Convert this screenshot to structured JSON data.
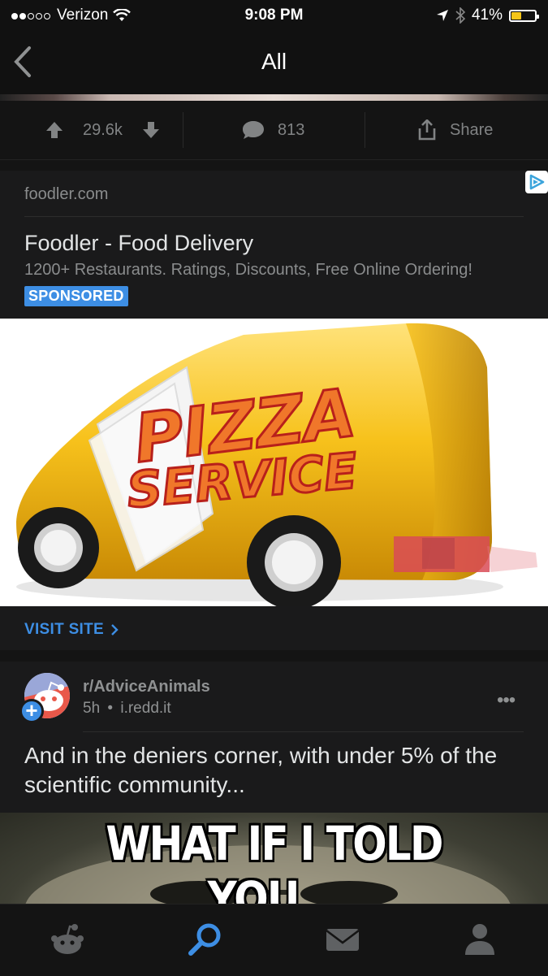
{
  "status_bar": {
    "carrier": "Verizon",
    "time": "9:08 PM",
    "battery": "41%",
    "battery_level": 0.41
  },
  "nav": {
    "title": "All",
    "back_icon": "chevron-left-icon"
  },
  "action_bar": {
    "score": "29.6k",
    "comments": "813",
    "share_label": "Share"
  },
  "ad": {
    "domain": "foodler.com",
    "title": "Foodler - Food Delivery",
    "description": "1200+ Restaurants. Ratings, Discounts, Free Online Ordering!",
    "badge": "SPONSORED",
    "image_text_line1": "PIZZA",
    "image_text_line2": "SERVICE",
    "cta": "VISIT SITE"
  },
  "post": {
    "subreddit": "r/AdviceAnimals",
    "age": "5h",
    "source": "i.redd.it",
    "title": "And in the deniers corner, with under 5% of the scientific community...",
    "image_caption": "WHAT IF I TOLD YOU..."
  },
  "tabs": [
    {
      "icon": "home-icon"
    },
    {
      "icon": "search-icon",
      "active": true
    },
    {
      "icon": "inbox-icon"
    },
    {
      "icon": "profile-icon"
    }
  ],
  "colors": {
    "accent": "#3d8ee4",
    "background": "#141414",
    "card": "#1a1a1b",
    "muted": "#818384"
  }
}
